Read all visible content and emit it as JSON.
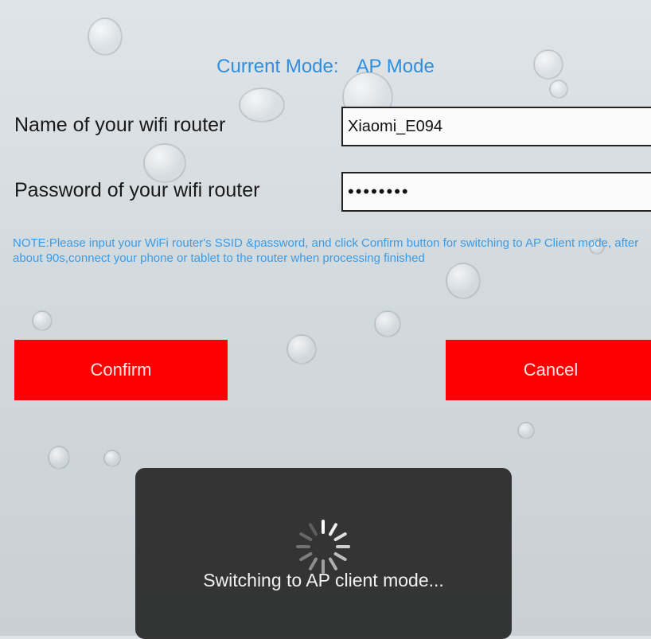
{
  "mode": {
    "label": "Current Mode:",
    "value": "AP Mode"
  },
  "router_name": {
    "label": "Name of your wifi router",
    "value": "Xiaomi_E094"
  },
  "router_password": {
    "label": "Password of your wifi router",
    "masked_value": "••••••••"
  },
  "note": "NOTE:Please input your WiFi router's SSID &password, and click Confirm button for switching to AP Client mode, after about 90s,connect your phone or tablet to the router when processing finished",
  "buttons": {
    "confirm": "Confirm",
    "cancel": "Cancel"
  },
  "toast": {
    "message": "Switching to AP client mode...",
    "icon": "spinner-icon"
  },
  "colors": {
    "accent_text": "#2e8fe0",
    "button_red": "#ff0000",
    "toast_bg": "#282828"
  }
}
